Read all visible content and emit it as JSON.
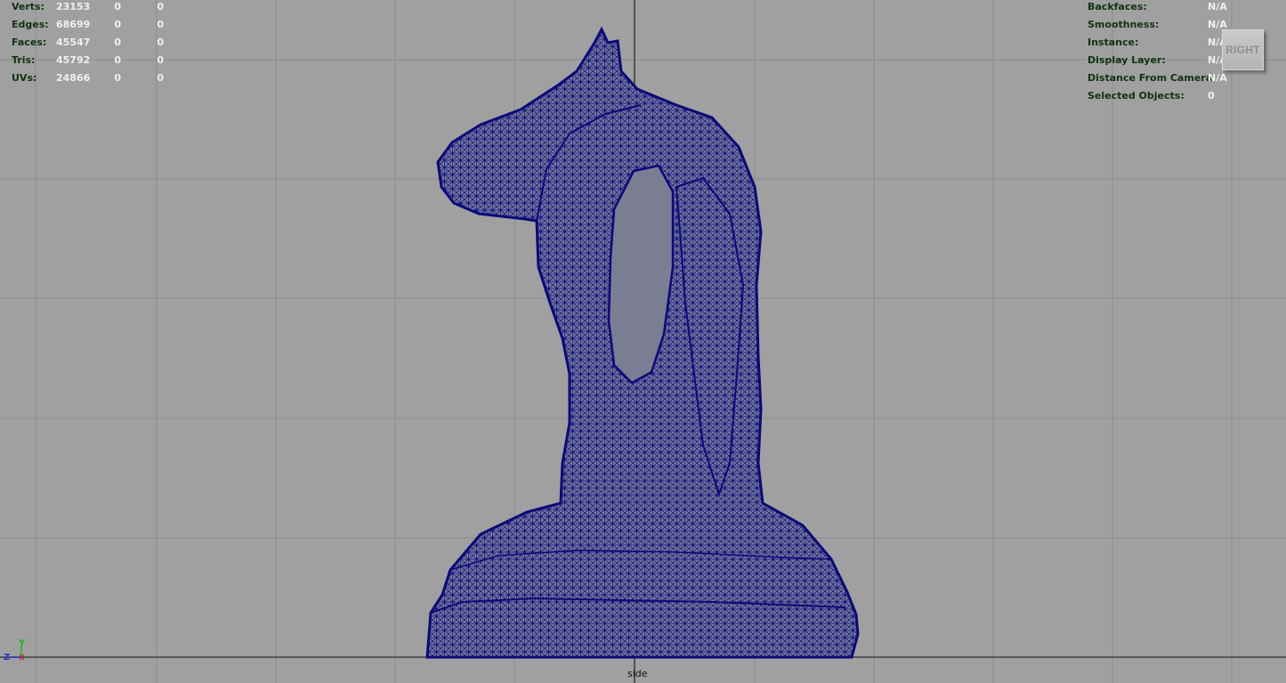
{
  "heads_up_left": {
    "rows": [
      {
        "label": "Verts:",
        "v1": "23153",
        "v2": "0",
        "v3": "0"
      },
      {
        "label": "Edges:",
        "v1": "68699",
        "v2": "0",
        "v3": "0"
      },
      {
        "label": "Faces:",
        "v1": "45547",
        "v2": "0",
        "v3": "0"
      },
      {
        "label": "Tris:",
        "v1": "45792",
        "v2": "0",
        "v3": "0"
      },
      {
        "label": "UVs:",
        "v1": "24866",
        "v2": "0",
        "v3": "0"
      }
    ]
  },
  "heads_up_right": {
    "rows": [
      {
        "label": "Backfaces:",
        "value": "N/A"
      },
      {
        "label": "Smoothness:",
        "value": "N/A"
      },
      {
        "label": "Instance:",
        "value": "N/A"
      },
      {
        "label": "Display Layer:",
        "value": "N/A"
      },
      {
        "label": "Distance From Camera:",
        "value": "N/A"
      },
      {
        "label": "Selected Objects:",
        "value": "0"
      }
    ]
  },
  "view_cube": {
    "label": "RIGHT"
  },
  "camera_label": "side",
  "axis_gizmo": {
    "y": "Y",
    "z": "Z"
  },
  "colors": {
    "viewport_bg": "#a0a0a0",
    "grid_line": "#8c8c8c",
    "axis_line": "#2a2a2a",
    "wireframe": "#0a0a8a",
    "mesh_fill": "#7a7a8e",
    "hud_label": "#10330f",
    "hud_value": "#f0f0f0"
  }
}
